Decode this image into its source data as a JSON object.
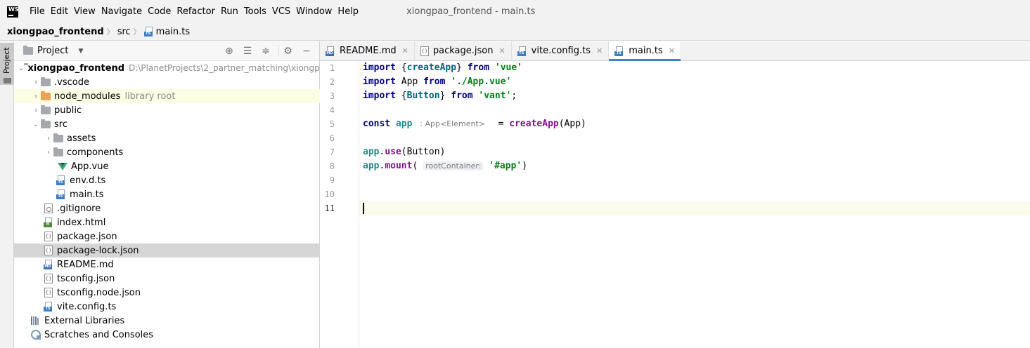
{
  "menubar": {
    "logo": "WS",
    "items": [
      "File",
      "Edit",
      "View",
      "Navigate",
      "Code",
      "Refactor",
      "Run",
      "Tools",
      "VCS",
      "Window",
      "Help"
    ],
    "window_title": "xiongpao_frontend - main.ts"
  },
  "breadcrumb": {
    "project": "xiongpao_frontend",
    "folder": "src",
    "file": "main.ts"
  },
  "leftstrip": {
    "project_tab": "Project"
  },
  "project_panel": {
    "title": "Project",
    "root_name": "xiongpao_frontend",
    "root_path": "D:\\PlanetProjects\\2_partner_matching\\xiongpa",
    "items": [
      {
        "label": ".vscode"
      },
      {
        "label": "node_modules",
        "note": "library root"
      },
      {
        "label": "public"
      },
      {
        "label": "src"
      },
      {
        "label": "assets"
      },
      {
        "label": "components"
      },
      {
        "label": "App.vue"
      },
      {
        "label": "env.d.ts"
      },
      {
        "label": "main.ts"
      },
      {
        "label": ".gitignore"
      },
      {
        "label": "index.html"
      },
      {
        "label": "package.json"
      },
      {
        "label": "package-lock.json"
      },
      {
        "label": "README.md"
      },
      {
        "label": "tsconfig.json"
      },
      {
        "label": "tsconfig.node.json"
      },
      {
        "label": "vite.config.ts"
      },
      {
        "label": "External Libraries"
      },
      {
        "label": "Scratches and Consoles"
      }
    ]
  },
  "editor": {
    "tabs": [
      {
        "label": "README.md",
        "icon": "MD"
      },
      {
        "label": "package.json",
        "icon": "{}"
      },
      {
        "label": "vite.config.ts",
        "icon": "TS"
      },
      {
        "label": "main.ts",
        "icon": "TS"
      }
    ],
    "line_numbers": [
      "1",
      "2",
      "3",
      "4",
      "5",
      "6",
      "7",
      "8",
      "9",
      "10",
      "11"
    ],
    "code": {
      "l1": {
        "kw1": "import",
        "p1": " {",
        "fn": "createApp",
        "p2": "} ",
        "kw2": "from",
        "sp": " ",
        "str": "'vue'"
      },
      "l2": {
        "kw1": "import",
        "p1": " App ",
        "kw2": "from",
        "sp": " ",
        "str": "'./App.vue'"
      },
      "l3": {
        "kw1": "import",
        "p1": " {",
        "fn": "Button",
        "p2": "} ",
        "kw2": "from",
        "sp": " ",
        "str": "'vant'",
        "end": ";"
      },
      "l5": {
        "kw": "const",
        "var": "app",
        "hint_colon": ":",
        "hint_type": "App<Element>",
        "eq": "= ",
        "fn": "createApp",
        "args": "(App)"
      },
      "l7": {
        "obj": "app",
        "dot": ".",
        "m": "use",
        "args": "(Button)"
      },
      "l8": {
        "obj": "app",
        "dot": ".",
        "m": "mount",
        "open": "(",
        "hint": "rootContainer:",
        "str": "'#app'",
        "close": ")"
      }
    }
  },
  "icons": {
    "locate": "crosshair-icon",
    "expand": "expand-all-icon",
    "collapse": "collapse-all-icon",
    "settings": "gear-icon",
    "hide": "minimize-icon"
  },
  "colors": {
    "keyword": "#000080",
    "string": "#067d17",
    "function": "#00627a",
    "tab_underline": "#4083c9",
    "selection": "#d5d5d5"
  }
}
